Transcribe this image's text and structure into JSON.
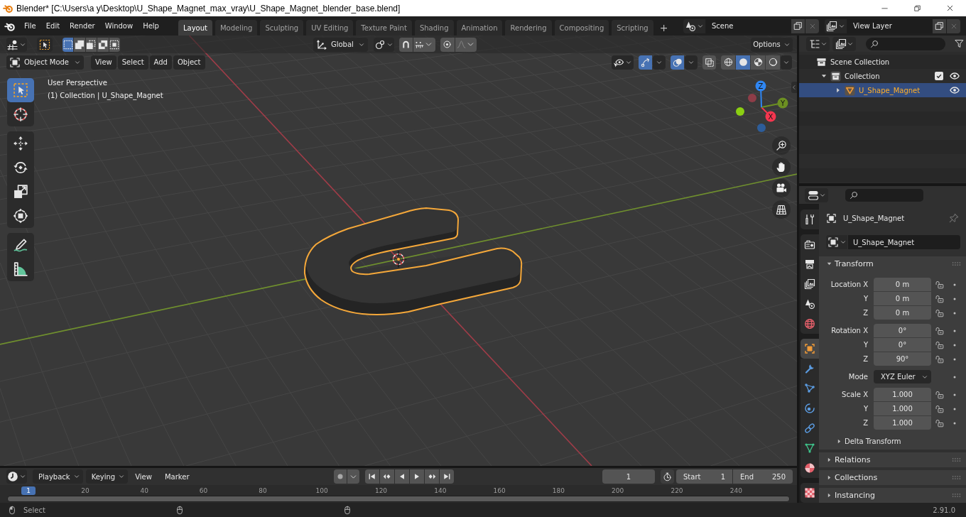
{
  "window": {
    "title": "Blender* [C:\\Users\\a y\\Desktop\\U_Shape_Magnet_max_vray\\U_Shape_Magnet_blender_base.blend]"
  },
  "top_bar": {
    "menus": [
      "File",
      "Edit",
      "Render",
      "Window",
      "Help"
    ],
    "workspaces": [
      {
        "label": "Layout",
        "selected": true
      },
      {
        "label": "Modeling",
        "selected": false
      },
      {
        "label": "Sculpting",
        "selected": false
      },
      {
        "label": "UV Editing",
        "selected": false
      },
      {
        "label": "Texture Paint",
        "selected": false
      },
      {
        "label": "Shading",
        "selected": false
      },
      {
        "label": "Animation",
        "selected": false
      },
      {
        "label": "Rendering",
        "selected": false
      },
      {
        "label": "Compositing",
        "selected": false
      },
      {
        "label": "Scripting",
        "selected": false
      }
    ],
    "add_tab": "+",
    "scene": "Scene",
    "view_layer": "View Layer"
  },
  "viewport": {
    "tool_header": {
      "selection_modes": [
        {
          "selected": true
        },
        {
          "selected": false
        },
        {
          "selected": false
        },
        {
          "selected": false
        },
        {
          "selected": false
        }
      ],
      "orientation": "Global",
      "snap": false,
      "proportional_editing": false,
      "options": "Options"
    },
    "header": {
      "mode": "Object Mode",
      "menus": [
        "View",
        "Select",
        "Add",
        "Object"
      ],
      "toggles": [
        {
          "kind": "gizmos",
          "on": true
        },
        {
          "kind": "overlays",
          "on": true
        },
        {
          "kind": "xray",
          "on": false
        }
      ],
      "shading": [
        {
          "kind": "wireframe",
          "selected": false
        },
        {
          "kind": "solid",
          "selected": true
        },
        {
          "kind": "material",
          "selected": false
        },
        {
          "kind": "rendered",
          "selected": false
        }
      ]
    },
    "info": [
      "User Perspective",
      "(1) Collection | U_Shape_Magnet"
    ],
    "tool_groups": [
      [
        {
          "kind": "select",
          "selected": true
        },
        {
          "kind": "cursor",
          "selected": false
        }
      ],
      [
        {
          "kind": "move",
          "selected": false
        },
        {
          "kind": "rotate",
          "selected": false
        },
        {
          "kind": "scale",
          "selected": false
        },
        {
          "kind": "transform",
          "selected": false
        }
      ],
      [
        {
          "kind": "annotate",
          "selected": false
        },
        {
          "kind": "measure",
          "selected": false
        }
      ]
    ],
    "gizmo": {
      "axes": [
        {
          "label": "X",
          "color": "#f5364f"
        },
        {
          "label": "Y",
          "color": "#6c8f22"
        },
        {
          "label": "Z",
          "color": "#2f86f2"
        }
      ]
    }
  },
  "outliner": {
    "tree": [
      {
        "label": "Scene Collection",
        "kind": "scene_collection",
        "selected": false,
        "children": [
          {
            "label": "Collection",
            "kind": "collection",
            "expanded": true,
            "checked": true,
            "visible": true,
            "selected": false,
            "children": [
              {
                "label": "U_Shape_Magnet",
                "kind": "object",
                "expanded": false,
                "visible": true,
                "selected": true
              }
            ]
          }
        ]
      }
    ]
  },
  "properties": {
    "tab_groups": [
      [
        {
          "kind": "tool",
          "selected": false
        }
      ],
      [
        {
          "kind": "render",
          "selected": false
        },
        {
          "kind": "output",
          "selected": false
        },
        {
          "kind": "view_layer",
          "selected": false
        },
        {
          "kind": "scene",
          "selected": false
        },
        {
          "kind": "world",
          "selected": false
        }
      ],
      [
        {
          "kind": "object",
          "selected": true
        },
        {
          "kind": "modifiers",
          "selected": false
        },
        {
          "kind": "particles",
          "selected": false
        },
        {
          "kind": "physics",
          "selected": false
        },
        {
          "kind": "constraints",
          "selected": false
        },
        {
          "kind": "data",
          "selected": false
        },
        {
          "kind": "material",
          "selected": false
        }
      ],
      [
        {
          "kind": "texture",
          "selected": false
        }
      ]
    ],
    "context": "U_Shape_Magnet",
    "pinned": false,
    "object_name": "U_Shape_Magnet",
    "panels": [
      {
        "title": "Transform",
        "expanded": true,
        "groups": [
          [
            {
              "label": "Location X",
              "value": "0 m",
              "kind": "number",
              "locked": false
            },
            {
              "label": "Y",
              "value": "0 m",
              "kind": "number",
              "locked": false
            },
            {
              "label": "Z",
              "value": "0 m",
              "kind": "number",
              "locked": false
            }
          ],
          [
            {
              "label": "Rotation X",
              "value": "0°",
              "kind": "number",
              "locked": false
            },
            {
              "label": "Y",
              "value": "0°",
              "kind": "number",
              "locked": false
            },
            {
              "label": "Z",
              "value": "90°",
              "kind": "number",
              "locked": false
            }
          ],
          [
            {
              "label": "Mode",
              "value": "XYZ Euler",
              "kind": "dropdown"
            }
          ],
          [
            {
              "label": "Scale X",
              "value": "1.000",
              "kind": "number",
              "locked": false
            },
            {
              "label": "Y",
              "value": "1.000",
              "kind": "number",
              "locked": false
            },
            {
              "label": "Z",
              "value": "1.000",
              "kind": "number",
              "locked": false
            }
          ]
        ],
        "subpanels": [
          {
            "title": "Delta Transform",
            "expanded": false
          }
        ]
      },
      {
        "title": "Relations",
        "expanded": false
      },
      {
        "title": "Collections",
        "expanded": false
      },
      {
        "title": "Instancing",
        "expanded": false
      }
    ]
  },
  "timeline": {
    "menus": [
      {
        "label": "Playback",
        "kind": "dropdown"
      },
      {
        "label": "Keying",
        "kind": "dropdown"
      },
      {
        "label": "View",
        "kind": "menu"
      },
      {
        "label": "Marker",
        "kind": "menu"
      }
    ],
    "auto_keying": false,
    "current_frame": "1",
    "start": {
      "label": "Start",
      "value": "1"
    },
    "end": {
      "label": "End",
      "value": "250"
    },
    "playhead": "1",
    "ticks": [
      "20",
      "40",
      "60",
      "80",
      "100",
      "120",
      "140",
      "160",
      "180",
      "200",
      "220",
      "240"
    ]
  },
  "status_bar": {
    "hint": "Select",
    "version": "2.91.0"
  }
}
